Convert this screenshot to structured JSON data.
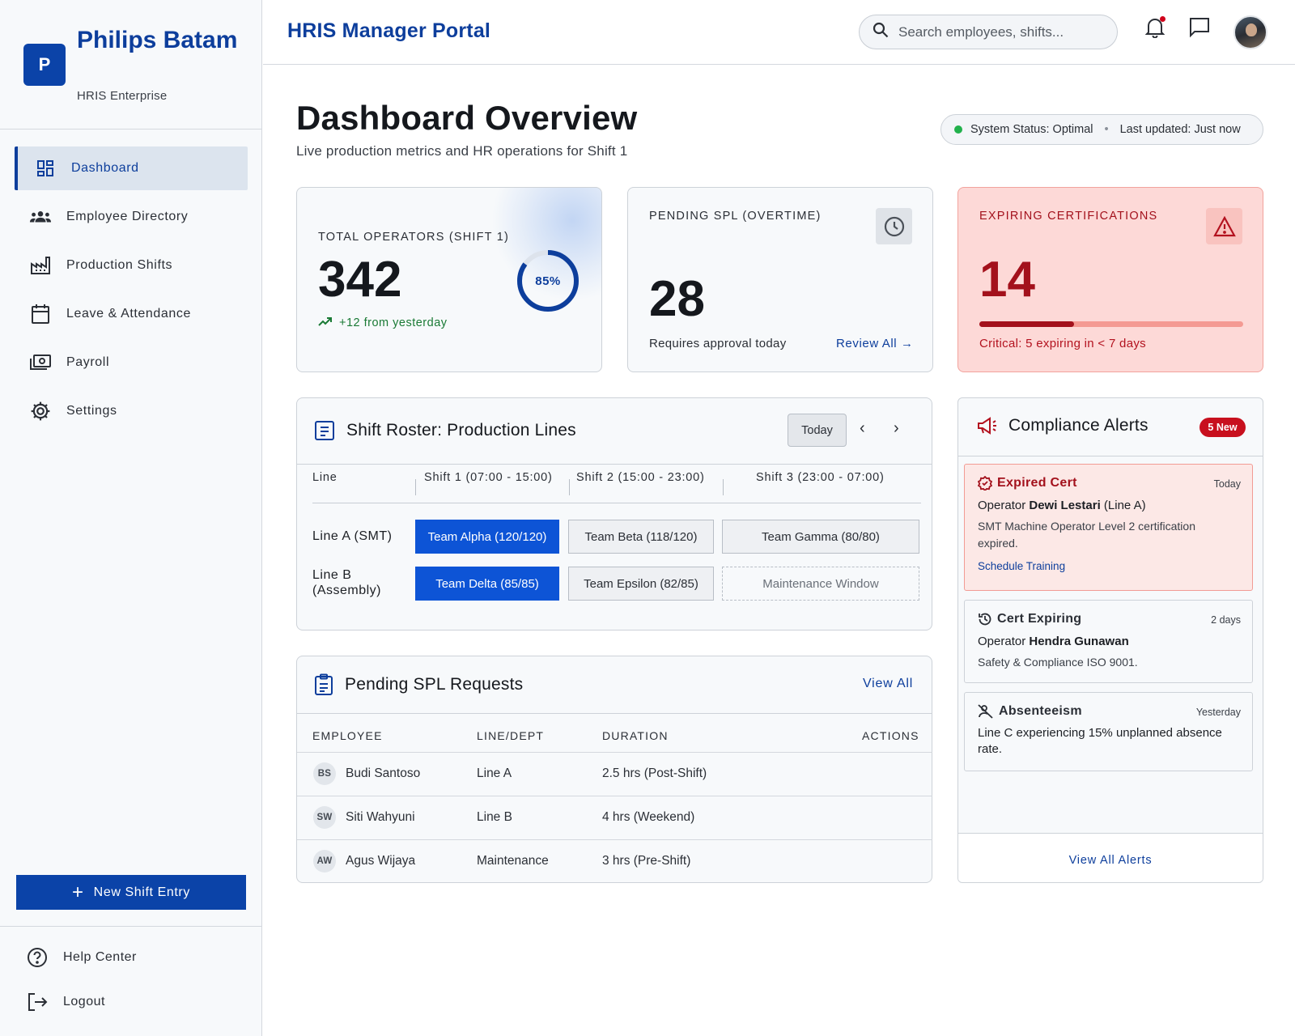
{
  "brand": {
    "logo_letter": "P",
    "name": "Philips Batam",
    "subtitle": "HRIS Enterprise"
  },
  "sidebar": {
    "items": [
      {
        "label": "Dashboard",
        "icon": "dashboard-icon",
        "active": true
      },
      {
        "label": "Employee Directory",
        "icon": "users-icon"
      },
      {
        "label": "Production Shifts",
        "icon": "factory-icon"
      },
      {
        "label": "Leave & Attendance",
        "icon": "calendar-icon"
      },
      {
        "label": "Payroll",
        "icon": "payments-icon"
      },
      {
        "label": "Settings",
        "icon": "gear-icon"
      }
    ],
    "new_shift_label": "New Shift Entry",
    "help_label": "Help Center",
    "logout_label": "Logout"
  },
  "topbar": {
    "title": "HRIS Manager Portal",
    "search_placeholder": "Search employees, shifts..."
  },
  "header": {
    "title": "Dashboard Overview",
    "subtitle": "Live production metrics and HR operations for Shift 1",
    "status": "System Status: Optimal",
    "last_updated": "Last updated: Just now",
    "status_color": "#22b14c"
  },
  "kpis": {
    "operators": {
      "label": "TOTAL OPERATORS (SHIFT 1)",
      "value": "342",
      "percent_label": "85%",
      "percent": 0.85,
      "trend": "+12 from yesterday"
    },
    "spl": {
      "label": "PENDING SPL (OVERTIME)",
      "value": "28",
      "note": "Requires approval today",
      "link": "Review All →"
    },
    "certs": {
      "label": "EXPIRING CERTIFICATIONS",
      "value": "14",
      "progress": 0.36,
      "note": "Critical: 5 expiring in < 7 days"
    }
  },
  "roster": {
    "title": "Shift Roster: Production Lines",
    "today_label": "Today",
    "headers": [
      "Line",
      "Shift 1 (07:00 - 15:00)",
      "Shift 2 (15:00 - 23:00)",
      "Shift 3 (23:00 - 07:00)"
    ],
    "rows": [
      {
        "line": "Line A (SMT)",
        "cells": [
          "Team Alpha (120/120)",
          "Team Beta (118/120)",
          "Team Gamma (80/80)"
        ]
      },
      {
        "line": "Line B (Assembly)",
        "cells": [
          "Team Delta (85/85)",
          "Team Epsilon (82/85)",
          "Maintenance Window"
        ]
      }
    ]
  },
  "spl_requests": {
    "title": "Pending SPL Requests",
    "view_all": "View All",
    "columns": [
      "EMPLOYEE",
      "LINE/DEPT",
      "DURATION",
      "ACTIONS"
    ],
    "rows": [
      {
        "initials": "BS",
        "name": "Budi Santoso",
        "line": "Line A",
        "duration": "2.5 hrs (Post-Shift)"
      },
      {
        "initials": "SW",
        "name": "Siti Wahyuni",
        "line": "Line B",
        "duration": "4 hrs (Weekend)"
      },
      {
        "initials": "AW",
        "name": "Agus Wijaya",
        "line": "Maintenance",
        "duration": "3 hrs (Pre-Shift)"
      }
    ]
  },
  "compliance": {
    "title": "Compliance Alerts",
    "badge": "5 New",
    "alerts": [
      {
        "type": "Expired Cert",
        "time": "Today",
        "prefix": "Operator ",
        "name": "Dewi Lestari",
        "suffix": " (Line A)",
        "desc": "SMT Machine Operator Level 2 certification expired.",
        "action": "Schedule Training"
      },
      {
        "type": "Cert Expiring",
        "time": "2 days",
        "prefix": "Operator ",
        "name": "Hendra Gunawan",
        "desc": "Safety & Compliance ISO 9001."
      },
      {
        "type": "Absenteeism",
        "time": "Yesterday",
        "desc": "Line C experiencing 15% unplanned absence rate."
      }
    ],
    "view_all": "View All Alerts"
  },
  "colors": {
    "brand": "#0b43a8",
    "accent": "#0d54d6",
    "danger": "#b3121f",
    "danger_bg": "#fdd9d7",
    "success": "#1a7a35"
  }
}
